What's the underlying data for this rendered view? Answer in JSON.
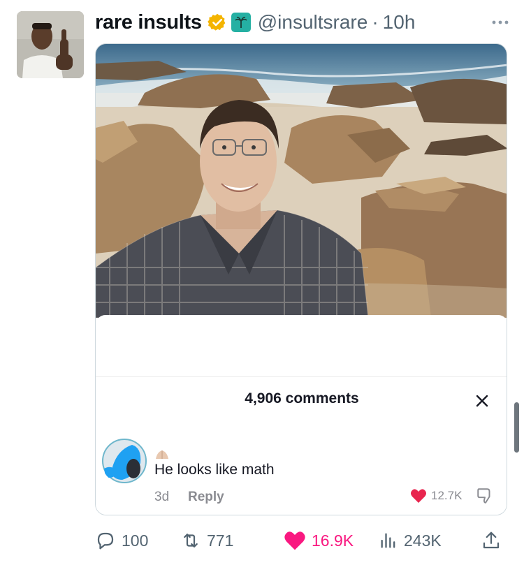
{
  "tweet": {
    "author_name": "rare insults",
    "handle": "@insultsrare",
    "separator": "·",
    "time": "10h",
    "more_icon": "ellipsis-icon",
    "verified_color": "#f4b400",
    "affiliate_color": "#25b0a3"
  },
  "embedded_comment": {
    "comments_count": "4,906 comments",
    "comment_text": "He looks like math",
    "comment_date": "3d",
    "reply_label": "Reply",
    "like_count": "12.7K",
    "like_color": "#e8254e"
  },
  "actions": {
    "replies": "100",
    "retweets": "771",
    "likes": "16.9K",
    "views": "243K",
    "like_color": "#f91880"
  }
}
